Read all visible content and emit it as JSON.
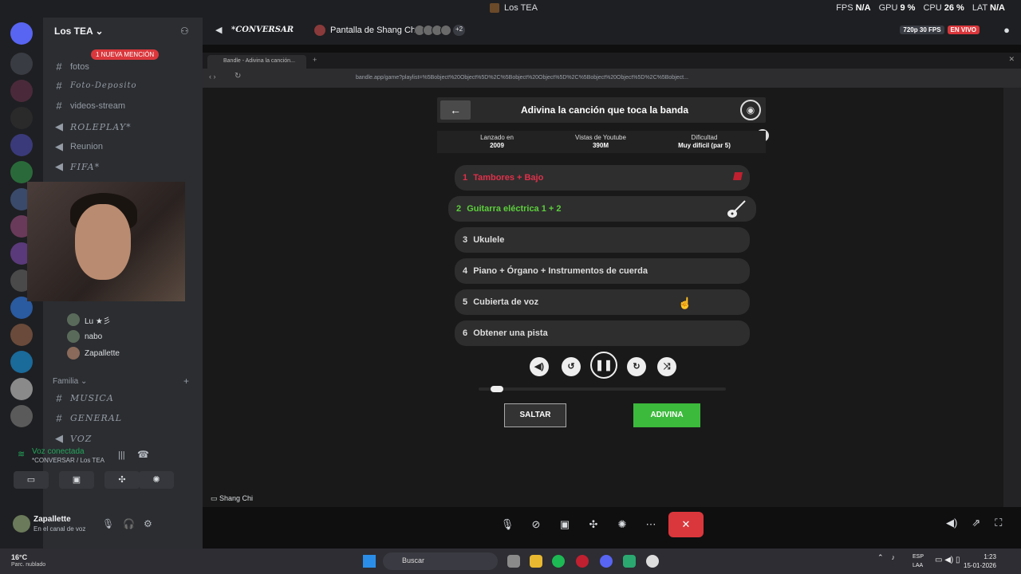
{
  "titlebar": {
    "title": "Los TEA"
  },
  "stats": {
    "fps_label": "FPS",
    "fps": "N/A",
    "gpu_label": "GPU",
    "gpu": "9 %",
    "cpu_label": "CPU",
    "cpu": "26 %",
    "lat_label": "LAT",
    "lat": "N/A"
  },
  "server": {
    "name": "Los TEA ⌄",
    "mention": "1 NUEVA MENCIÓN"
  },
  "channels": [
    {
      "name": "fotos",
      "icon": "hash-icon"
    },
    {
      "name": "Foto-Deposito",
      "icon": "hash-icon"
    },
    {
      "name": "videos-stream",
      "icon": "hash-icon"
    },
    {
      "name": "ROLEPLAY*",
      "icon": "speaker-icon"
    },
    {
      "name": "Reunion",
      "icon": "speaker-icon"
    },
    {
      "name": "FIFA*",
      "icon": "speaker-icon"
    }
  ],
  "members": [
    {
      "name": "Lu ★彡"
    },
    {
      "name": "nabo"
    },
    {
      "name": "Zapallette"
    }
  ],
  "category": {
    "name": "Familia ⌄"
  },
  "channels2": [
    {
      "name": "MUSICA",
      "icon": "hash-icon"
    },
    {
      "name": "GENERAL",
      "icon": "hash-icon"
    },
    {
      "name": "VOZ",
      "icon": "speaker-icon"
    }
  ],
  "voice": {
    "status": "Voz conectada",
    "channel": "*CONVERSAR / Los TEA"
  },
  "user": {
    "name": "Zapallette",
    "status": "En el canal de voz"
  },
  "stream": {
    "channel": "*CONVERSAR",
    "title": "Pantalla de Shang Chi",
    "extra_viewers": "+2",
    "quality": "720p 30 FPS",
    "live": "EN VIVO",
    "sharer": "Shang Chi"
  },
  "browser": {
    "tab_title": "Bandle - Adivina la canción...",
    "url": "bandle.app/game?playlist=%5Bobject%20Object%5D%2C%5Bobject%20Object%5D%2C%5Bobject%20Object%5D%2C%5Bobject..."
  },
  "game": {
    "title": "Adivina la canción que toca la banda",
    "info": [
      {
        "label": "Lanzado en",
        "value": "2009"
      },
      {
        "label": "Vistas de Youtube",
        "value": "390M"
      },
      {
        "label": "Dificultad",
        "value": "Muy difícil (par 5)"
      }
    ],
    "clues": [
      {
        "num": "1",
        "text": "Tambores + Bajo",
        "state": "wrong"
      },
      {
        "num": "2",
        "text": "Guitarra eléctrica 1 + 2",
        "state": "active"
      },
      {
        "num": "3",
        "text": "Ukulele",
        "state": "locked"
      },
      {
        "num": "4",
        "text": "Piano + Órgano + Instrumentos de cuerda",
        "state": "locked"
      },
      {
        "num": "5",
        "text": "Cubierta de voz",
        "state": "locked"
      },
      {
        "num": "6",
        "text": "Obtener una pista",
        "state": "locked"
      }
    ],
    "progress": 0.05,
    "skip_label": "SALTAR",
    "guess_label": "ADIVINA",
    "colors": {
      "wrong": "#e0304a",
      "active": "#5ccf3c",
      "guess": "#3cba3c"
    }
  },
  "taskbar": {
    "temp": "16°C",
    "weather": "Parc. nublado",
    "search": "Buscar",
    "lang1": "ESP",
    "lang2": "LAA",
    "time": "1:23",
    "date": "15-01-2026"
  }
}
